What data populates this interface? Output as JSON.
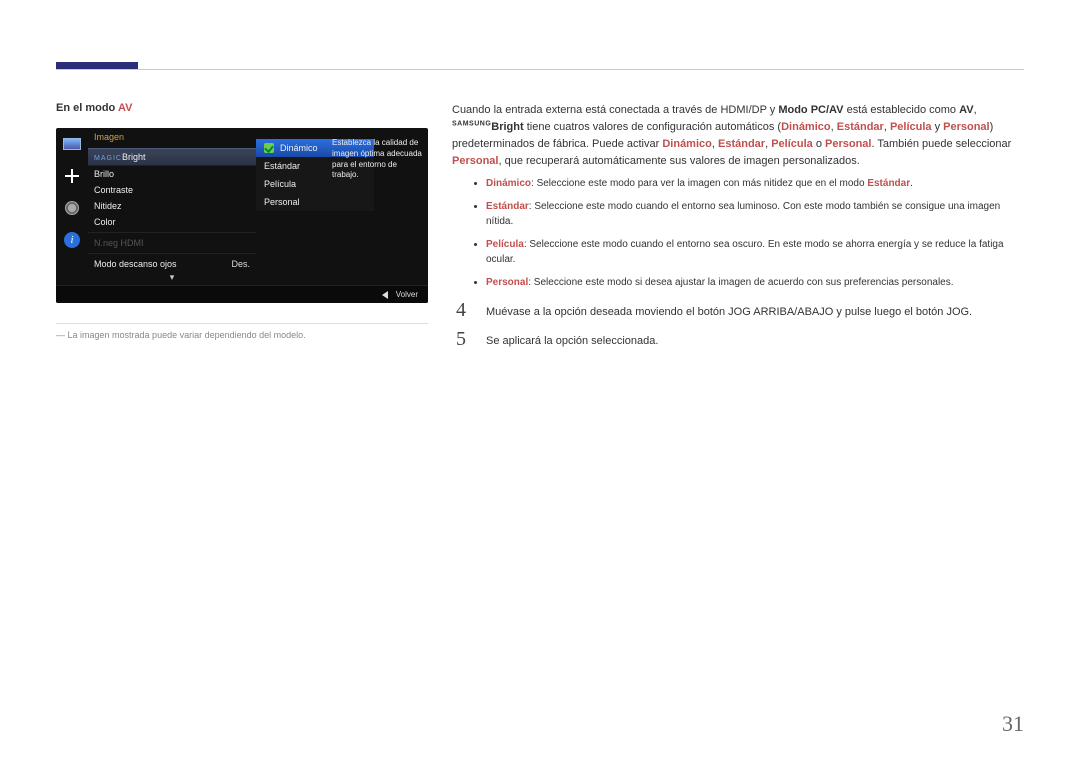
{
  "header": {
    "mode_prefix": "En el modo ",
    "mode_suffix": "AV"
  },
  "osd": {
    "section_title": "Imagen",
    "magic_brand": "SAMSUNG",
    "magic_sub": "MAGIC",
    "magic_word": "Bright",
    "items": {
      "brillo": "Brillo",
      "contraste": "Contraste",
      "nitidez": "Nitidez",
      "color": "Color",
      "nneg": "N.neg HDMI",
      "eye": "Modo descanso ojos",
      "eye_val": "Des."
    },
    "submenu": {
      "dinamico": "Dinámico",
      "estandar": "Estándar",
      "pelicula": "Película",
      "personal": "Personal"
    },
    "desc": "Establezca la calidad de imagen óptima adecuada para el entorno de trabajo.",
    "footer_back": "Volver"
  },
  "caption": "La imagen mostrada puede variar dependiendo del modelo.",
  "intro": {
    "t1a": "Cuando la entrada externa está conectada a través de HDMI/DP y ",
    "t1b": "Modo PC/AV",
    "t1c": " está establecido como ",
    "t1d": "AV",
    "t1e": ", ",
    "brand_top": "SAMSUNG",
    "brand_bot": "MAGIC",
    "bright": "Bright",
    "t1f": " tiene cuatros valores de configuración automáticos (",
    "m1": "Dinámico",
    "m2": "Estándar",
    "m3": "Película",
    "m4": "Personal",
    "t1g": ") predeterminados de fábrica. Puede activar ",
    "t1h": ". También puede seleccionar ",
    "t1i": ", que recuperará automáticamente sus valores de imagen personalizados.",
    "sep": ", ",
    "y": " y ",
    "o": " o "
  },
  "modes": {
    "dinamico_t": "Dinámico",
    "dinamico_d1": ": Seleccione este modo para ver la imagen con más nitidez que en el modo ",
    "dinamico_d2": "Estándar",
    "dinamico_d3": ".",
    "estandar_t": "Estándar",
    "estandar_d": ": Seleccione este modo cuando el entorno sea luminoso. Con este modo también se consigue una imagen nítida.",
    "pelicula_t": "Película",
    "pelicula_d": ": Seleccione este modo cuando el entorno sea oscuro. En este modo se ahorra energía y se reduce la fatiga ocular.",
    "personal_t": "Personal",
    "personal_d": ": Seleccione este modo si desea ajustar la imagen de acuerdo con sus preferencias personales."
  },
  "steps": {
    "n4": "4",
    "s4": "Muévase a la opción deseada moviendo el botón JOG ARRIBA/ABAJO y pulse luego el botón JOG.",
    "n5": "5",
    "s5": "Se aplicará la opción seleccionada."
  },
  "page_number": "31"
}
